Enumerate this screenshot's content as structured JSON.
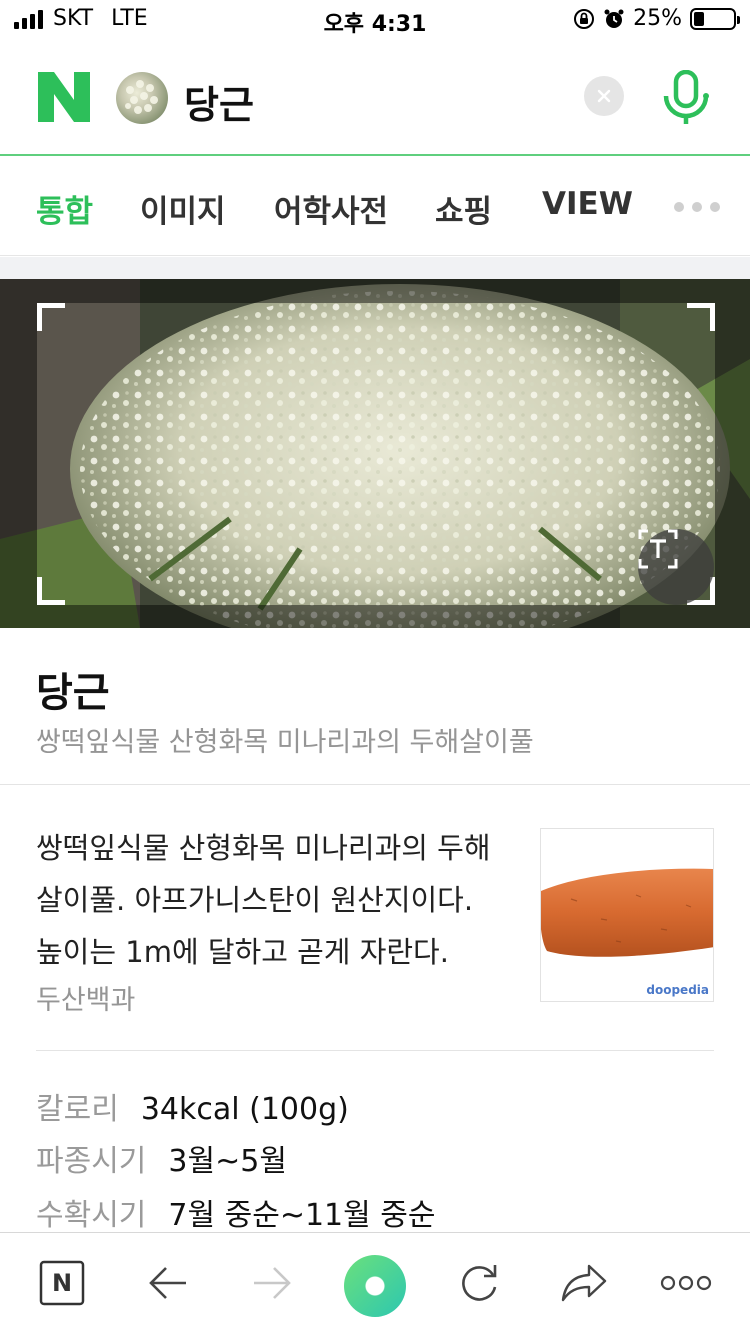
{
  "status_bar": {
    "carrier": "SKT",
    "network": "LTE",
    "time": "오후 4:31",
    "battery": "25%",
    "battery_level": 0.25
  },
  "search": {
    "query": "당근",
    "logo_icon": "naver-n-logo",
    "clear_icon": "close-icon",
    "mic_icon": "microphone-icon"
  },
  "tabs": [
    {
      "label": "통합",
      "active": true
    },
    {
      "label": "이미지",
      "active": false
    },
    {
      "label": "어학사전",
      "active": false
    },
    {
      "label": "쇼핑",
      "active": false
    },
    {
      "label": "VIEW",
      "active": false
    }
  ],
  "result": {
    "title": "당근",
    "subtitle": "쌍떡잎식물 산형화목 미나리과의 두해살이풀",
    "summary": "쌍떡잎식물 산형화목 미나리과의 두해살이풀. 아프가니스탄이 원산지이다. 높이는 1m에 달하고 곧게 자란다.",
    "source": "두산백과",
    "thumb_brand": "doopedia"
  },
  "info": [
    {
      "label": "칼로리",
      "value": "34kcal (100g)"
    },
    {
      "label": "파종시기",
      "value": "3월~5월"
    },
    {
      "label": "수확시기",
      "value": "7월 중순~11월 중순"
    }
  ],
  "toolbar": {
    "home_label": "N",
    "icons": [
      "naver-home-icon",
      "back-arrow-icon",
      "forward-arrow-icon",
      "green-dot-icon",
      "reload-icon",
      "share-icon",
      "more-icon"
    ]
  },
  "colors": {
    "brand_green": "#2dbf5a",
    "search_border": "#5fcf7e",
    "muted_text": "#959595"
  }
}
